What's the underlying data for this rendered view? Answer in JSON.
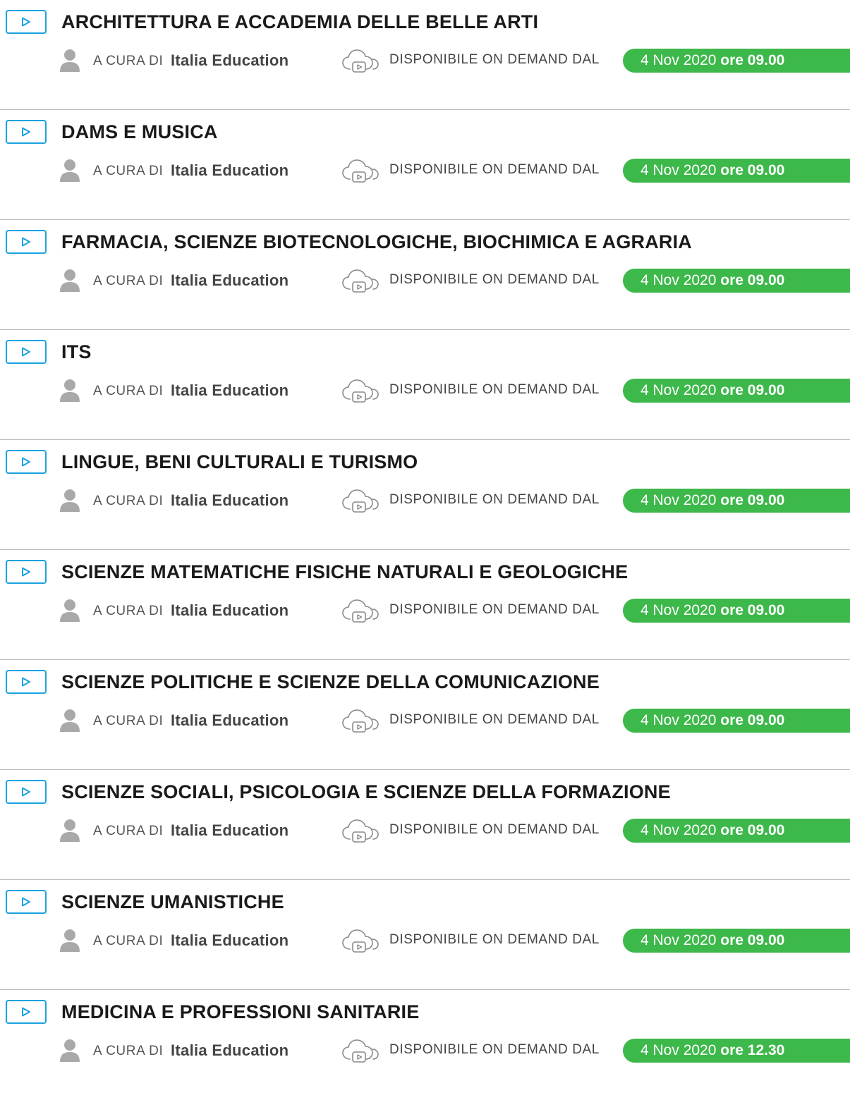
{
  "common": {
    "curated_by_label": "A CURA DI",
    "curated_by_org": "Italia Education",
    "on_demand_label": "DISPONIBILE ON DEMAND DAL"
  },
  "colors": {
    "accent_blue": "#1aa3e0",
    "date_green": "#3db84a",
    "divider": "#b8b8b8"
  },
  "icons": {
    "play": "play-triangle-icon",
    "user": "user-icon",
    "cloud": "cloud-play-icon"
  },
  "items": [
    {
      "title": "ARCHITETTURA E ACCADEMIA DELLE BELLE ARTI",
      "date": "4 Nov 2020",
      "time": "ore 09.00"
    },
    {
      "title": "DAMS E MUSICA",
      "date": "4 Nov 2020",
      "time": "ore 09.00"
    },
    {
      "title": "FARMACIA, SCIENZE BIOTECNOLOGICHE, BIOCHIMICA E AGRARIA",
      "date": "4 Nov 2020",
      "time": "ore 09.00"
    },
    {
      "title": "ITS",
      "date": "4 Nov 2020",
      "time": "ore 09.00"
    },
    {
      "title": "LINGUE, BENI CULTURALI E TURISMO",
      "date": "4 Nov 2020",
      "time": "ore 09.00"
    },
    {
      "title": "SCIENZE MATEMATICHE FISICHE NATURALI E GEOLOGICHE",
      "date": "4 Nov 2020",
      "time": "ore 09.00"
    },
    {
      "title": "SCIENZE POLITICHE E SCIENZE DELLA COMUNICAZIONE",
      "date": "4 Nov 2020",
      "time": "ore 09.00"
    },
    {
      "title": "SCIENZE SOCIALI, PSICOLOGIA E SCIENZE DELLA FORMAZIONE",
      "date": "4 Nov 2020",
      "time": "ore 09.00"
    },
    {
      "title": "SCIENZE UMANISTICHE",
      "date": "4 Nov 2020",
      "time": "ore 09.00"
    },
    {
      "title": "MEDICINA E PROFESSIONI SANITARIE",
      "date": "4 Nov 2020",
      "time": "ore 12.30"
    }
  ]
}
